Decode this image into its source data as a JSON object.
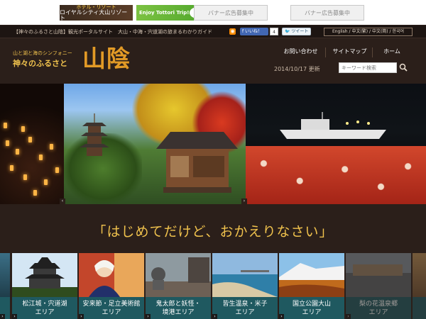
{
  "banners": {
    "b1_top": "ホテル・リゾート",
    "b1_bottom": "ロイヤルシティ大山リゾート",
    "b2": "Enjoy Tottori Trip!",
    "ad1": "バナー広告募集中",
    "ad2": "バナー広告募集中"
  },
  "infobar": {
    "text": "【神々のふるさと山陰】観光ポータルサイト　大山・中海・宍道湖の旅まるわかりガイド",
    "facebook": "いいね！",
    "facebook_count": "4",
    "twitter": "ツイート",
    "languages": "English / 中文(繁) / 中文(简) / 한국어"
  },
  "header": {
    "tagline": "山と湖と海のシンフォニー",
    "site_name": "神々のふるさと",
    "logo": "山陰",
    "nav": [
      "お問い合わせ",
      "サイトマップ",
      "ホーム"
    ],
    "updated": "2014/10/17 更新",
    "search_placeholder": "キーワード検索"
  },
  "message": "「はじめてだけど、おかえりなさい」",
  "areas": [
    {
      "label_1": "",
      "label_2": ""
    },
    {
      "label_1": "松江城・宍道湖",
      "label_2": "エリア"
    },
    {
      "label_1": "安来節・足立美術館",
      "label_2": "エリア"
    },
    {
      "label_1": "鬼太郎と妖怪・",
      "label_2": "境港エリア"
    },
    {
      "label_1": "皆生温泉・米子",
      "label_2": "エリア"
    },
    {
      "label_1": "国立公園大山",
      "label_2": "エリア"
    },
    {
      "label_1": "梨の花温泉郷",
      "label_2": "エリア"
    },
    {
      "label_1": "",
      "label_2": ""
    }
  ],
  "colors": {
    "background": "#2b1f1a",
    "accent_gold": "#f0c24d",
    "logo_orange": "#e29a26",
    "card_teal": "#1f5960"
  }
}
